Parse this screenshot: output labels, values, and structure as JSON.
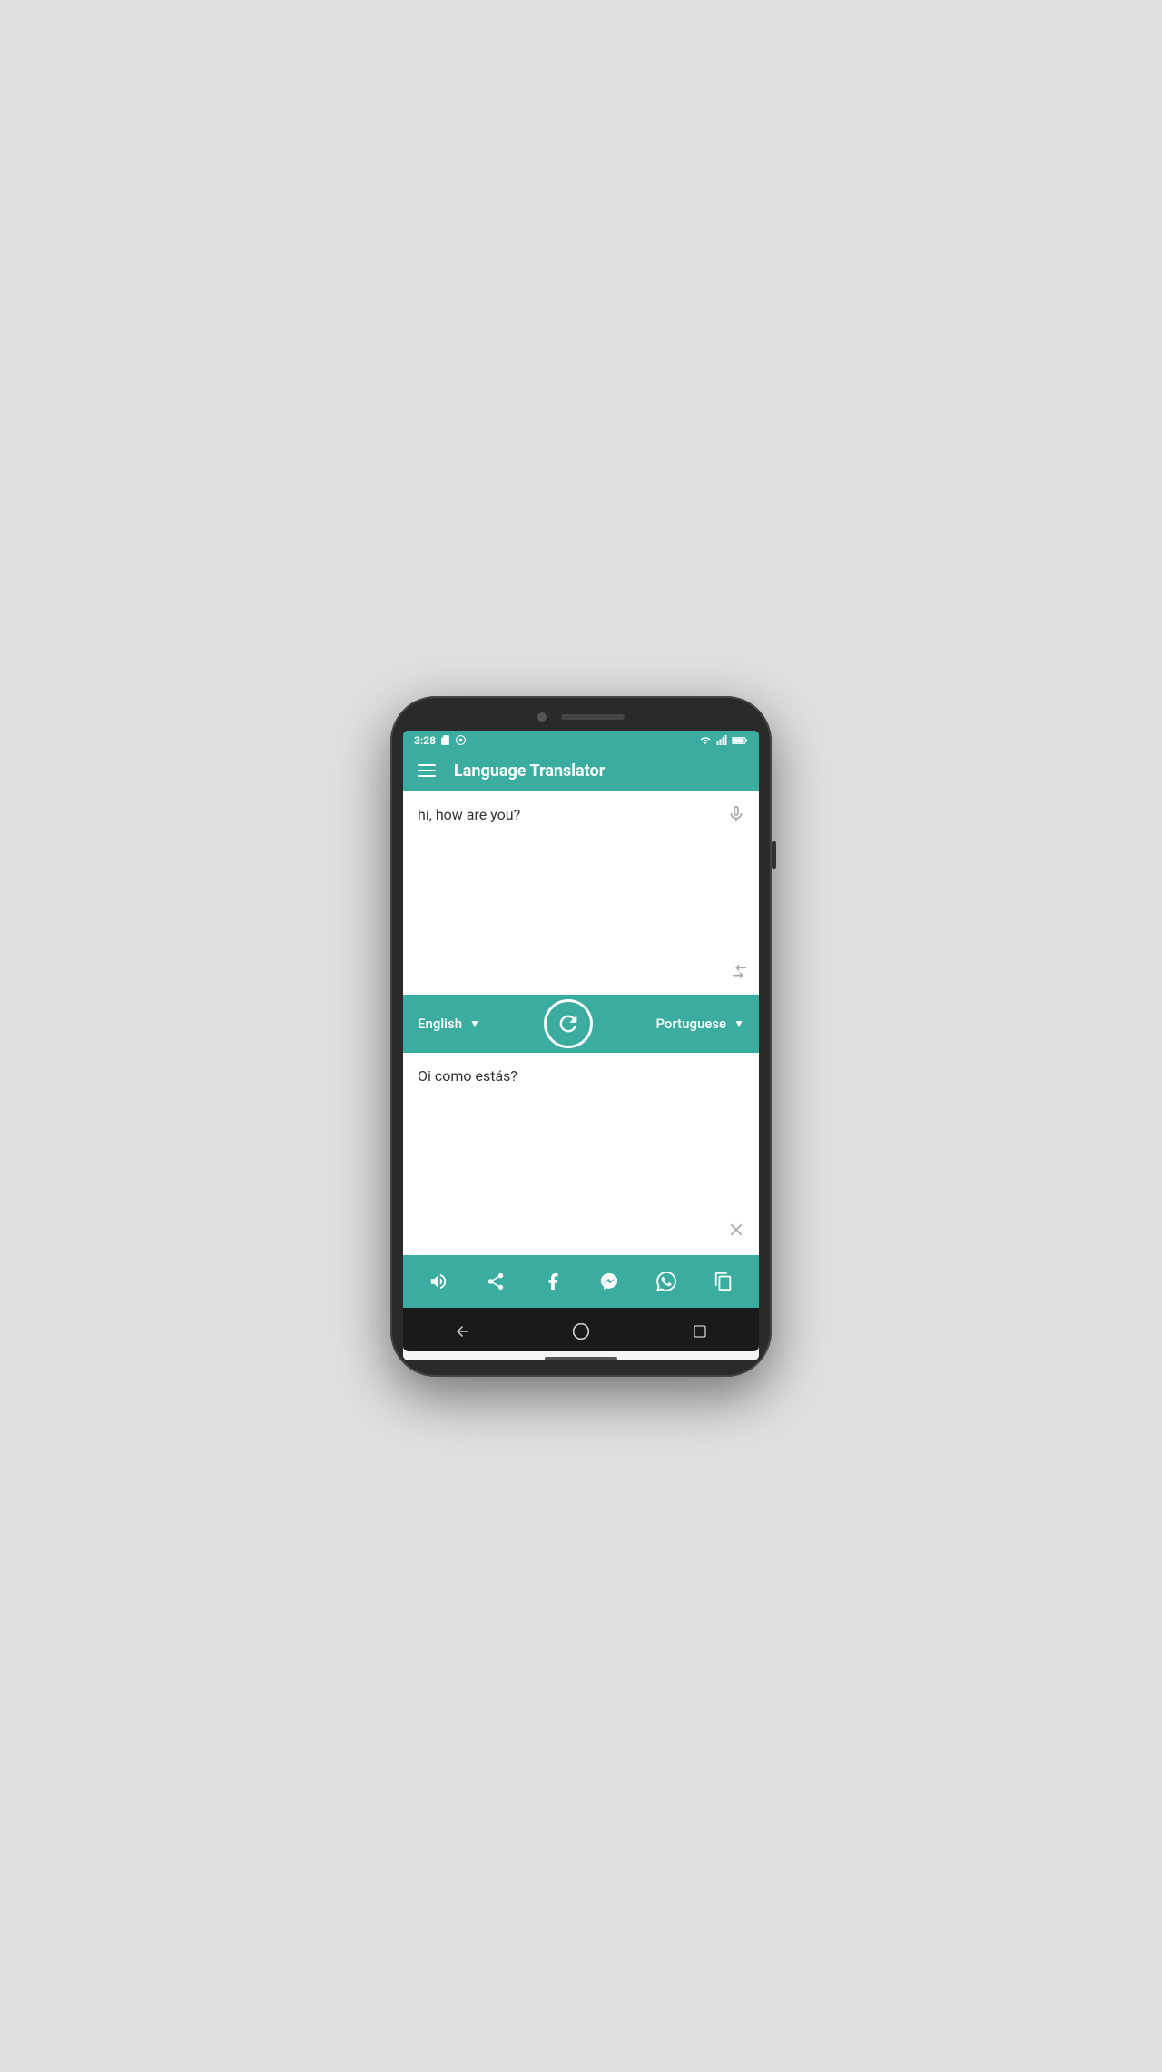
{
  "status_bar": {
    "time": "3:28",
    "icons": [
      "sd-card",
      "location",
      "wifi",
      "signal",
      "battery"
    ]
  },
  "app_bar": {
    "title": "Language Translator",
    "menu_icon": "hamburger"
  },
  "input_section": {
    "text": "hi, how are you?",
    "mic_icon": "microphone",
    "swap_icon": "swap-vertical"
  },
  "language_bar": {
    "source_language": "English",
    "target_language": "Portuguese",
    "swap_button_icon": "refresh-circle",
    "source_dropdown_icon": "chevron-down",
    "target_dropdown_icon": "chevron-down"
  },
  "output_section": {
    "text": "Oi como estás?",
    "close_icon": "close-x"
  },
  "action_bar": {
    "buttons": [
      {
        "icon": "volume-up",
        "label": "speak"
      },
      {
        "icon": "share",
        "label": "share"
      },
      {
        "icon": "facebook",
        "label": "facebook"
      },
      {
        "icon": "messenger",
        "label": "messenger"
      },
      {
        "icon": "whatsapp",
        "label": "whatsapp"
      },
      {
        "icon": "copy",
        "label": "copy"
      }
    ]
  },
  "nav_bar": {
    "back_icon": "triangle-left",
    "home_icon": "circle",
    "recent_icon": "square"
  },
  "colors": {
    "teal": "#3aaca0",
    "white": "#ffffff",
    "dark": "#2a2a2a",
    "text": "#333333",
    "icon_gray": "#aaaaaa"
  }
}
